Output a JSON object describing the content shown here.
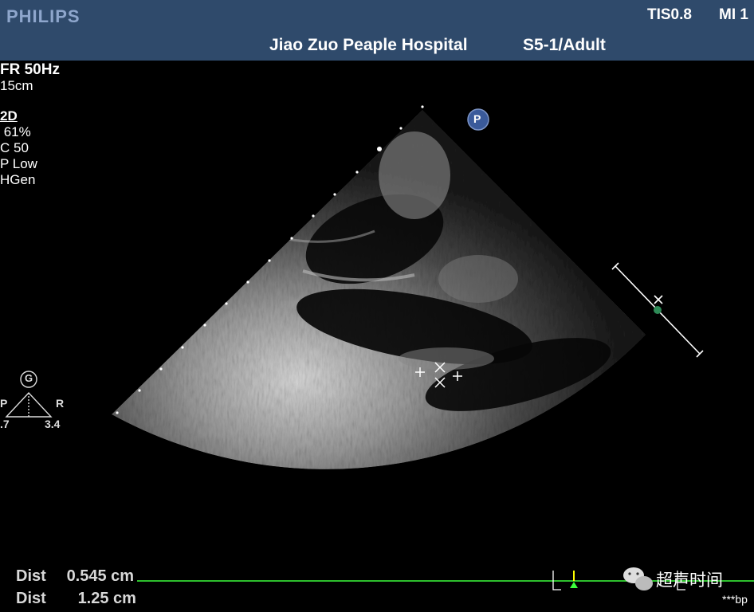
{
  "header": {
    "brand": "PHILIPS",
    "thermal_index": "TIS0.8",
    "mech_index": "MI 1",
    "hospital": "Jiao Zuo Peaple Hospital",
    "probe_preset": "S5-1/Adult"
  },
  "acquisition": {
    "frame_rate": "FR 50Hz",
    "depth": "15cm",
    "mode": "2D",
    "gain": " 61%",
    "compression": "C 50",
    "persistence": "P Low",
    "frequency": "HGen"
  },
  "orientation": {
    "marker_letter": "P",
    "gen_badge": "G",
    "left_label": "P",
    "right_label": "R",
    "left_value": ".7",
    "right_value": "3.4"
  },
  "measurements": [
    {
      "label": "Dist",
      "value": "0.545 cm"
    },
    {
      "label": "Dist",
      "value": "1.25 cm"
    }
  ],
  "watermark": "超声时间",
  "patient_id_tail": "***bp",
  "colors": {
    "header_bg": "#2f4a6b",
    "ecg_line": "#3cff3c",
    "focus_marker": "#2e8b57",
    "marker_blue": "#3a5a9a"
  }
}
